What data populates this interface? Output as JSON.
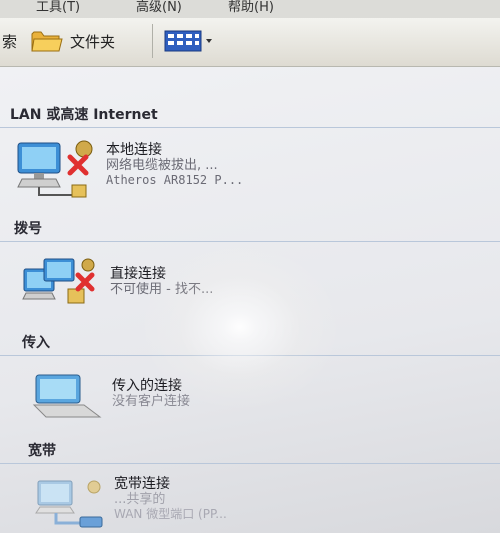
{
  "menu": {
    "tools": "工具(T)",
    "advanced": "高级(N)",
    "help": "帮助(H)"
  },
  "toolbar": {
    "search_tail": "索",
    "folders_label": "文件夹",
    "views_icon": "views-grid-icon"
  },
  "groups": [
    {
      "header": "LAN 或高速 Internet",
      "items": [
        {
          "name": "本地连接",
          "status": "网络电缆被拔出, ...",
          "device": "Atheros AR8152 P...",
          "icon": "lan-connection-disconnected-icon"
        }
      ]
    },
    {
      "header": "拨号",
      "items": [
        {
          "name": "直接连接",
          "status": "不可使用 - 找不...",
          "icon": "direct-connection-unavailable-icon"
        }
      ]
    },
    {
      "header": "传入",
      "items": [
        {
          "name": "传入的连接",
          "status": "没有客户连接",
          "icon": "incoming-connections-icon"
        }
      ]
    },
    {
      "header": "宽带",
      "items": [
        {
          "name": "宽带连接",
          "status": "...共享的",
          "device": "WAN 微型端口 (PP...",
          "icon": "broadband-connection-icon"
        }
      ]
    }
  ],
  "colors": {
    "header_text": "#2a2a33",
    "divider": "#b9c7da",
    "error_x": "#e03030",
    "monitor_blue": "#2d7fc8"
  }
}
